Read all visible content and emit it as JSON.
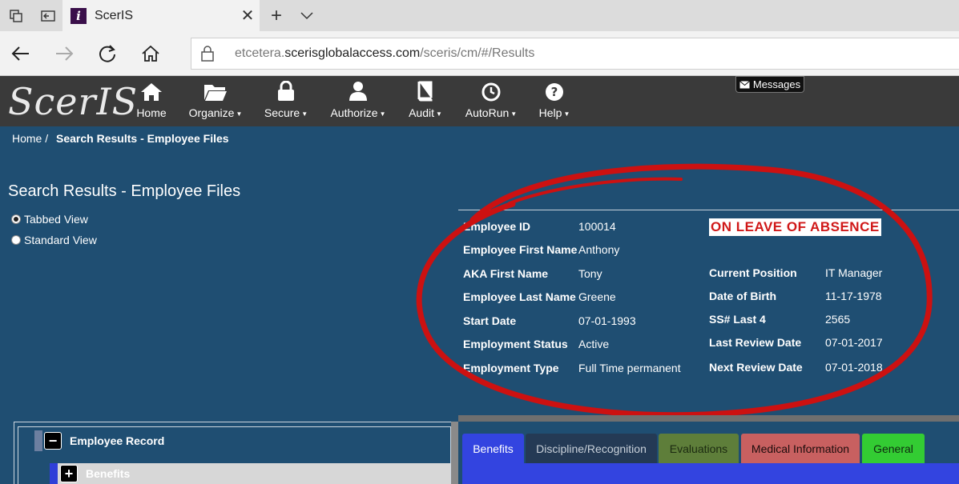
{
  "browser": {
    "tab_title": "ScerIS",
    "favicon_letter": "i",
    "url_prefix": "etcetera.",
    "url_domain": "scerisglobalaccess.com",
    "url_path": "/sceris/cm/#/Results"
  },
  "app": {
    "logo": "ScerIS",
    "messages_label": "Messages",
    "menu": [
      {
        "label": "Home",
        "icon": "home-icon"
      },
      {
        "label": "Organize",
        "icon": "folder-icon"
      },
      {
        "label": "Secure",
        "icon": "lock-icon"
      },
      {
        "label": "Authorize",
        "icon": "user-icon"
      },
      {
        "label": "Audit",
        "icon": "book-icon"
      },
      {
        "label": "AutoRun",
        "icon": "clock-icon"
      },
      {
        "label": "Help",
        "icon": "help-icon"
      }
    ]
  },
  "breadcrumb": {
    "home": "Home /",
    "current": "Search Results - Employee Files"
  },
  "page": {
    "title": "Search Results - Employee Files",
    "views": [
      {
        "label": "Tabbed View",
        "selected": true
      },
      {
        "label": "Standard View",
        "selected": false
      }
    ]
  },
  "employee": {
    "status_banner": "ON LEAVE OF ABSENCE",
    "left_fields": [
      {
        "label": "Employee ID",
        "value": "100014"
      },
      {
        "label": "Employee First Name",
        "value": "Anthony"
      },
      {
        "label": "AKA First Name",
        "value": "Tony"
      },
      {
        "label": "Employee Last Name",
        "value": "Greene"
      },
      {
        "label": "Start Date",
        "value": "07-01-1993"
      },
      {
        "label": "Employment Status",
        "value": "Active"
      },
      {
        "label": "Employment Type",
        "value": "Full Time permanent"
      }
    ],
    "right_fields": [
      {
        "label": "Current Position",
        "value": "IT Manager"
      },
      {
        "label": "Date of Birth",
        "value": "11-17-1978"
      },
      {
        "label": "SS# Last 4",
        "value": "2565"
      },
      {
        "label": "Last Review Date",
        "value": "07-01-2017"
      },
      {
        "label": "Next Review Date",
        "value": "07-01-2018"
      }
    ]
  },
  "tree": {
    "root": {
      "label": "Employee Record",
      "toggle": "−"
    },
    "child": {
      "label": "Benefits",
      "toggle": "+"
    }
  },
  "tabs": [
    {
      "label": "Benefits",
      "bg": "#3344e0",
      "fg": "#ffffff"
    },
    {
      "label": "Discipline/Recognition",
      "bg": "#243a55",
      "fg": "#c9d1da"
    },
    {
      "label": "Evaluations",
      "bg": "#5e7e3a",
      "fg": "#1b2a10"
    },
    {
      "label": "Medical Information",
      "bg": "#c86060",
      "fg": "#1c0c0c"
    },
    {
      "label": "General",
      "bg": "#33cc33",
      "fg": "#0f2a0f"
    }
  ]
}
